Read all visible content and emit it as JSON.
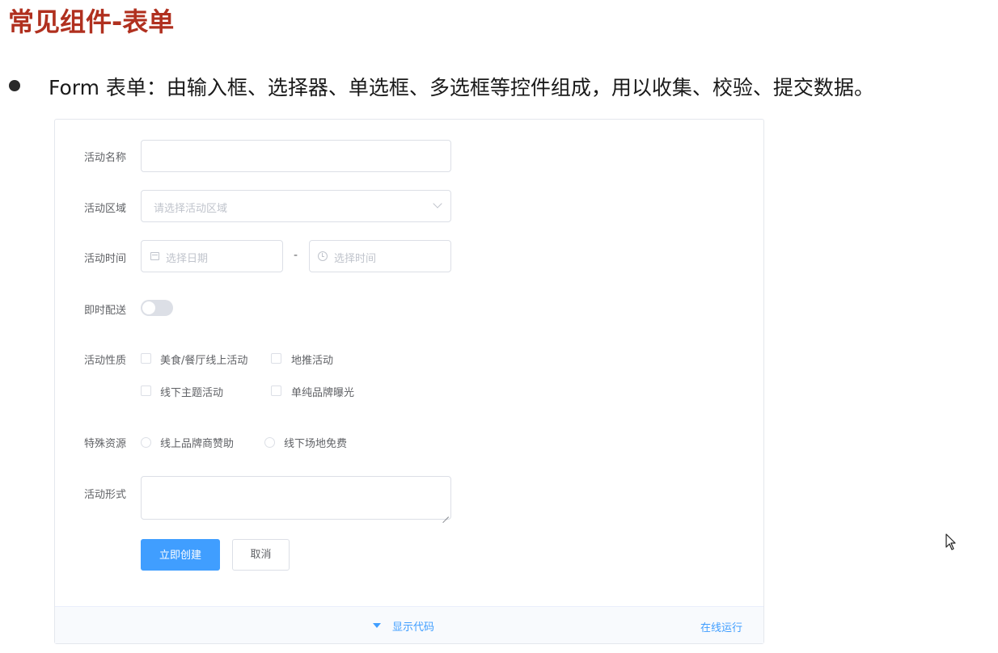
{
  "slide": {
    "title": "常见组件-表单",
    "bullet": "Form 表单：由输入框、选择器、单选框、多选框等控件组成，用以收集、校验、提交数据。"
  },
  "form": {
    "name_label": "活动名称",
    "name_value": "",
    "region_label": "活动区域",
    "region_placeholder": "请选择活动区域",
    "time_label": "活动时间",
    "date_placeholder": "选择日期",
    "time_separator": "-",
    "time_placeholder": "选择时间",
    "delivery_label": "即时配送",
    "delivery_on": false,
    "type_label": "活动性质",
    "type_options": [
      {
        "label": "美食/餐厅线上活动",
        "checked": false
      },
      {
        "label": "地推活动",
        "checked": false
      },
      {
        "label": "线下主题活动",
        "checked": false
      },
      {
        "label": "单纯品牌曝光",
        "checked": false
      }
    ],
    "resource_label": "特殊资源",
    "resource_options": [
      {
        "label": "线上品牌商赞助",
        "checked": false
      },
      {
        "label": "线下场地免费",
        "checked": false
      }
    ],
    "desc_label": "活动形式",
    "desc_value": "",
    "submit_label": "立即创建",
    "cancel_label": "取消"
  },
  "footer": {
    "show_code_label": "显示代码",
    "run_online_label": "在线运行"
  },
  "colors": {
    "title": "#b0301f",
    "primary": "#409eff",
    "border": "#dcdfe6",
    "placeholder": "#c0c4cc",
    "label": "#606266"
  }
}
